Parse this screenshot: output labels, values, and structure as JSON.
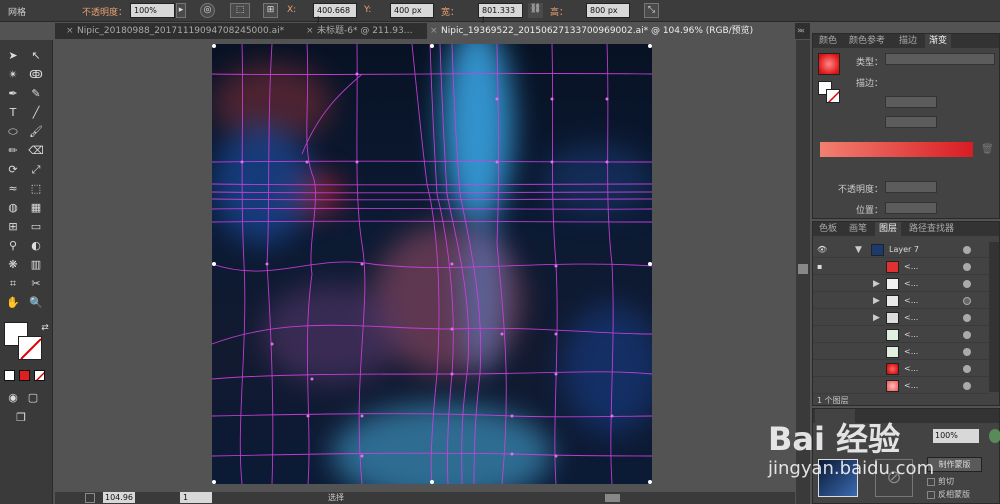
{
  "control_bar": {
    "mode_label": "网格",
    "opacity_label": "不透明度：",
    "opacity_value": "100%",
    "x_label": "X:",
    "x_value": "400.668 j",
    "y_label": "Y:",
    "y_value": "400 px",
    "w_label": "宽：",
    "w_value": "801.333 j",
    "h_label": "高：",
    "h_value": "800 px"
  },
  "tabs": [
    {
      "label": "Nipic_20180988_20171119094708245000.ai*"
    },
    {
      "label": "未标题-6* @ 211.93…"
    },
    {
      "label": "Nipic_19369522_20150627133700969002.ai* @ 104.96% (RGB/预览)"
    }
  ],
  "gradient_panel": {
    "tabs": [
      "颜色",
      "颜色参考",
      "描边",
      "渐变"
    ],
    "type_label": "类型：",
    "stroke_label": "描边：",
    "opacity_label": "不透明度：",
    "position_label": "位置："
  },
  "layers_panel": {
    "tabs": [
      "色板",
      "画笔",
      "图层",
      "路径查找器"
    ],
    "layer_name": "Layer 7",
    "sublayer_label": "<...",
    "footer_count": "1 个图层"
  },
  "transparency_panel": {
    "opacity_value": "100%",
    "make_mask_label": "制作蒙版",
    "clip_label": "剪切",
    "invert_label": "反相蒙版"
  },
  "status_bar": {
    "zoom_value": "104.96",
    "page_value": "1",
    "tool_label": "选择"
  },
  "watermark": {
    "text": "Bai 经验",
    "url": "jingyan.baidu.com"
  }
}
